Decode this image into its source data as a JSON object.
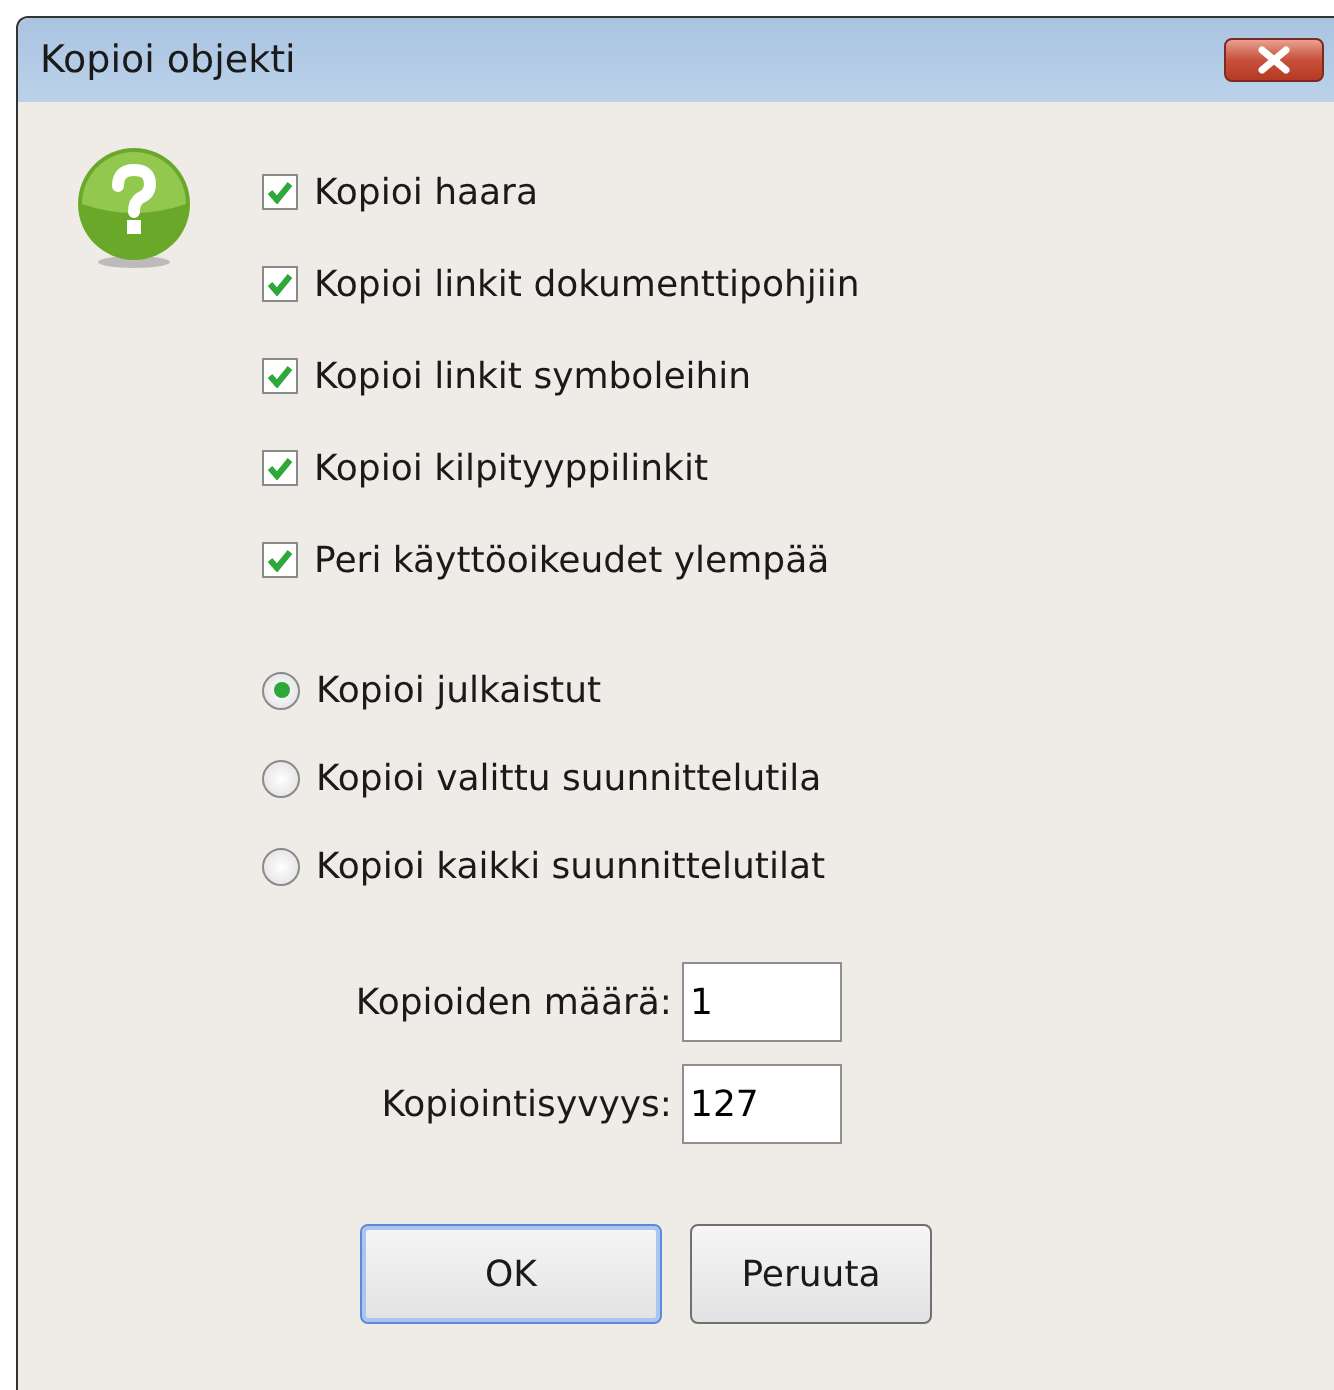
{
  "window": {
    "title": "Kopioi objekti"
  },
  "checkboxes": [
    {
      "label": "Kopioi haara",
      "checked": true
    },
    {
      "label": "Kopioi linkit dokumenttipohjiin",
      "checked": true
    },
    {
      "label": "Kopioi linkit symboleihin",
      "checked": true
    },
    {
      "label": "Kopioi kilpityyppilinkit",
      "checked": true
    },
    {
      "label": "Peri käyttöoikeudet ylempää",
      "checked": true
    }
  ],
  "radios": [
    {
      "label": "Kopioi julkaistut",
      "selected": true
    },
    {
      "label": "Kopioi valittu suunnittelutila",
      "selected": false
    },
    {
      "label": "Kopioi kaikki suunnittelutilat",
      "selected": false
    }
  ],
  "fields": [
    {
      "label": "Kopioiden määrä:",
      "value": "1"
    },
    {
      "label": "Kopiointisyvyys:",
      "value": "127"
    }
  ],
  "buttons": [
    {
      "label": "OK",
      "default": true
    },
    {
      "label": "Peruuta",
      "default": false
    }
  ]
}
